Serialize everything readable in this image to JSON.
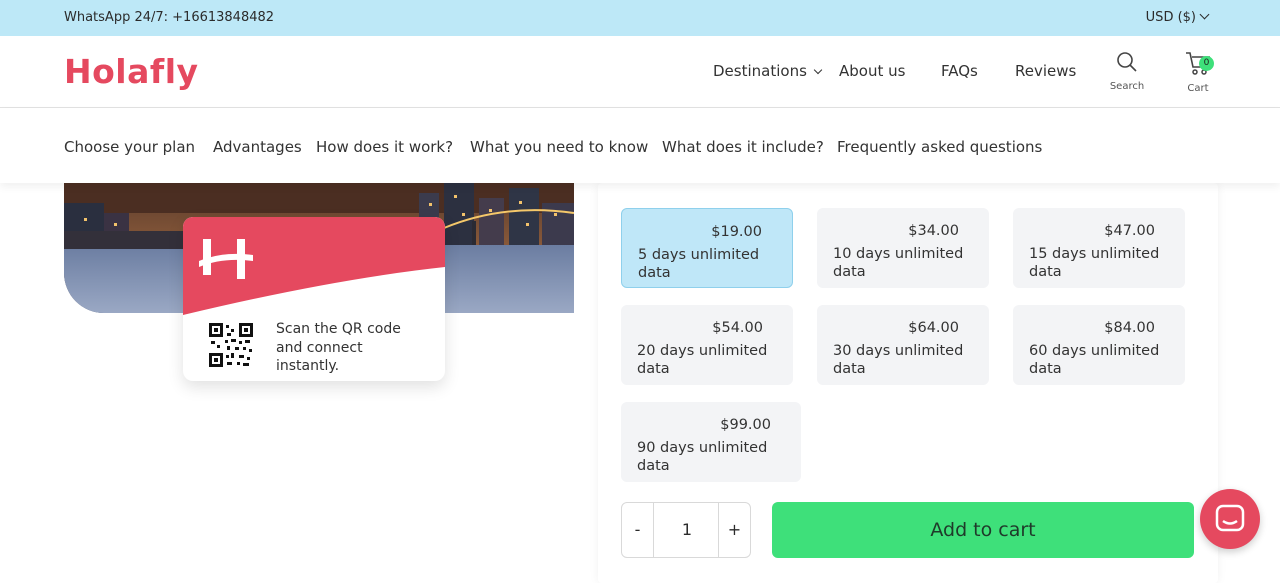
{
  "topbar": {
    "whatsapp": "WhatsApp 24/7: +16613848482",
    "currency": "USD ($)"
  },
  "header": {
    "logo": "Holafly",
    "nav": [
      "Destinations",
      "About us",
      "FAQs",
      "Reviews"
    ],
    "search_label": "Search",
    "cart_label": "Cart",
    "cart_count": "0"
  },
  "subnav": [
    "Choose your plan",
    "Advantages",
    "How does it work?",
    "What you need to know",
    "What does it include?",
    "Frequently asked questions"
  ],
  "card": {
    "scan_text": "Scan the QR code and connect instantly."
  },
  "plans": [
    {
      "price": "$19.00",
      "desc": "5 days unlimited data",
      "selected": true
    },
    {
      "price": "$34.00",
      "desc": "10 days unlimited data",
      "selected": false
    },
    {
      "price": "$47.00",
      "desc": "15 days unlimited data",
      "selected": false
    },
    {
      "price": "$54.00",
      "desc": "20 days unlimited data",
      "selected": false
    },
    {
      "price": "$64.00",
      "desc": "30 days unlimited data",
      "selected": false
    },
    {
      "price": "$84.00",
      "desc": "60 days unlimited data",
      "selected": false
    },
    {
      "price": "$99.00",
      "desc": "90 days unlimited data",
      "selected": false
    }
  ],
  "quantity": {
    "minus": "-",
    "value": "1",
    "plus": "+"
  },
  "add_to_cart": "Add to cart",
  "colors": {
    "brand": "#e5495f",
    "topbar": "#bde8f7",
    "cta": "#3ee07a",
    "selected": "#bfe7f8"
  }
}
